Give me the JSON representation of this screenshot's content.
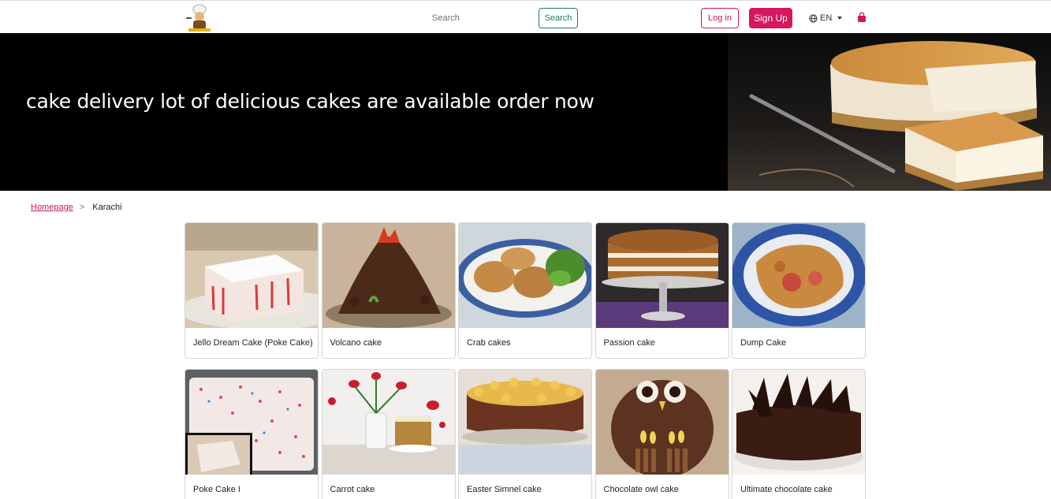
{
  "header": {
    "search_placeholder": "Search",
    "search_button": "Search",
    "login_button": "Log in",
    "signup_button": "Sign Up",
    "language": "EN",
    "icons": [
      "chef-logo-icon",
      "globe-icon",
      "chevron-down-icon",
      "shopping-bag-icon"
    ]
  },
  "hero": {
    "title": "cake delivery lot of delicious cakes are available order now"
  },
  "breadcrumb": {
    "home": "Homepage",
    "separator": ">",
    "current": "Karachi"
  },
  "products": [
    {
      "name": "Jello Dream Cake (Poke Cake)"
    },
    {
      "name": "Volcano cake"
    },
    {
      "name": "Crab cakes"
    },
    {
      "name": "Passion cake"
    },
    {
      "name": "Dump Cake"
    },
    {
      "name": "Poke Cake I"
    },
    {
      "name": "Carrot cake"
    },
    {
      "name": "Easter Simnel cake"
    },
    {
      "name": "Chocolate owl cake"
    },
    {
      "name": "Ultimate chocolate cake"
    }
  ],
  "colors": {
    "brand_pink": "#d6165d",
    "search_green": "#1a7f5a",
    "hero_bg": "#000000"
  }
}
